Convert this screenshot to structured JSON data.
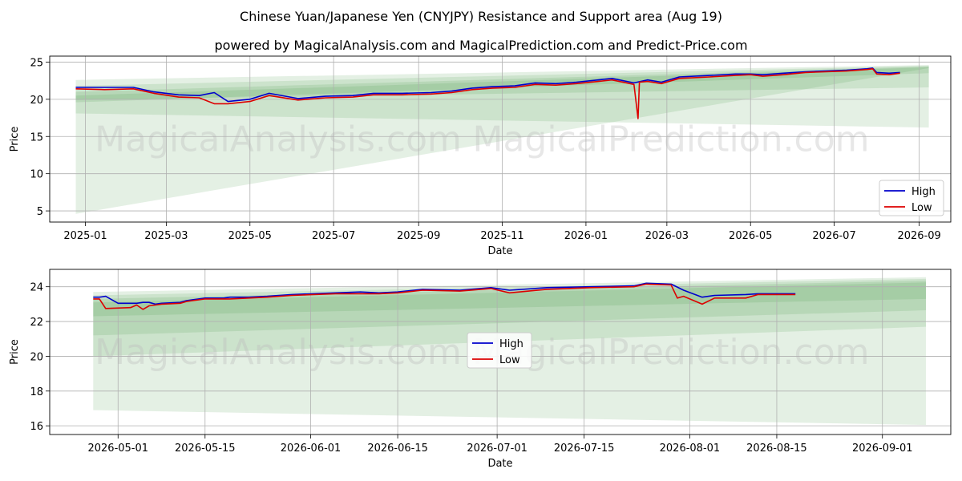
{
  "title": "Chinese Yuan/Japanese Yen (CNYJPY) Resistance and Support area (Aug 19)",
  "subtitle": "powered by MagicalAnalysis.com and MagicalPrediction.com and Predict-Price.com",
  "watermarks": [
    "MagicalAnalysis.com",
    "MagicalPrediction.com"
  ],
  "colors": {
    "high": "#0000cc",
    "low": "#dd0000",
    "band": "#2e8b2e",
    "grid": "#b0b0b0"
  },
  "chart_data": [
    {
      "type": "line",
      "xlabel": "Date",
      "ylabel": "Price",
      "ylim": [
        3.5,
        25.8
      ],
      "xlim": [
        "2024-12-06",
        "2026-09-24"
      ],
      "grid": true,
      "legend_position": "lower right",
      "x_ticks": [
        "2025-01",
        "2025-03",
        "2025-05",
        "2025-07",
        "2025-09",
        "2025-11",
        "2026-01",
        "2026-03",
        "2026-05",
        "2026-07",
        "2026-09"
      ],
      "y_ticks": [
        5,
        10,
        15,
        20,
        25
      ],
      "series": [
        {
          "name": "High",
          "color": "#0000cc",
          "x": [
            "2024-12-25",
            "2025-01-15",
            "2025-02-05",
            "2025-02-20",
            "2025-03-10",
            "2025-03-25",
            "2025-04-05",
            "2025-04-15",
            "2025-05-01",
            "2025-05-15",
            "2025-06-05",
            "2025-06-25",
            "2025-07-15",
            "2025-07-30",
            "2025-08-20",
            "2025-09-10",
            "2025-09-25",
            "2025-10-10",
            "2025-10-25",
            "2025-11-10",
            "2025-11-25",
            "2025-12-10",
            "2025-12-25",
            "2026-01-10",
            "2026-01-20",
            "2026-02-05",
            "2026-02-15",
            "2026-02-25",
            "2026-03-10",
            "2026-04-01",
            "2026-04-20",
            "2026-05-01",
            "2026-05-10",
            "2026-05-25",
            "2026-06-10",
            "2026-06-25",
            "2026-07-10",
            "2026-07-25",
            "2026-07-29",
            "2026-08-01",
            "2026-08-10",
            "2026-08-18"
          ],
          "y": [
            21.6,
            21.6,
            21.6,
            21.0,
            20.6,
            20.5,
            20.9,
            19.7,
            20.0,
            20.8,
            20.1,
            20.4,
            20.5,
            20.8,
            20.8,
            20.9,
            21.1,
            21.5,
            21.7,
            21.8,
            22.2,
            22.1,
            22.3,
            22.6,
            22.8,
            22.2,
            22.6,
            22.3,
            23.0,
            23.2,
            23.4,
            23.4,
            23.3,
            23.5,
            23.7,
            23.8,
            23.9,
            24.1,
            24.2,
            23.6,
            23.5,
            23.6
          ]
        },
        {
          "name": "Low",
          "color": "#dd0000",
          "x": [
            "2024-12-25",
            "2025-01-15",
            "2025-02-05",
            "2025-02-20",
            "2025-03-10",
            "2025-03-25",
            "2025-04-05",
            "2025-04-15",
            "2025-05-01",
            "2025-05-15",
            "2025-06-05",
            "2025-06-25",
            "2025-07-15",
            "2025-07-30",
            "2025-08-20",
            "2025-09-10",
            "2025-09-25",
            "2025-10-10",
            "2025-10-25",
            "2025-11-10",
            "2025-11-25",
            "2025-12-10",
            "2025-12-25",
            "2026-01-10",
            "2026-01-20",
            "2026-02-05",
            "2026-02-08",
            "2026-02-09",
            "2026-02-15",
            "2026-02-25",
            "2026-03-10",
            "2026-04-01",
            "2026-04-20",
            "2026-05-01",
            "2026-05-10",
            "2026-05-25",
            "2026-06-10",
            "2026-06-25",
            "2026-07-10",
            "2026-07-25",
            "2026-07-29",
            "2026-08-01",
            "2026-08-10",
            "2026-08-18"
          ],
          "y": [
            21.4,
            21.3,
            21.4,
            20.8,
            20.3,
            20.2,
            19.4,
            19.4,
            19.7,
            20.5,
            19.9,
            20.2,
            20.3,
            20.6,
            20.6,
            20.7,
            20.9,
            21.3,
            21.5,
            21.6,
            22.0,
            21.9,
            22.1,
            22.4,
            22.6,
            22.0,
            17.4,
            22.3,
            22.4,
            22.1,
            22.8,
            23.0,
            23.2,
            23.3,
            23.1,
            23.3,
            23.6,
            23.7,
            23.8,
            24.0,
            24.1,
            23.4,
            23.3,
            23.5
          ]
        }
      ],
      "bands": [
        {
          "x_start": "2024-12-25",
          "x_end": "2026-09-08",
          "upper": [
            22.6,
            24.6
          ],
          "lower": [
            4.6,
            24.2
          ]
        },
        {
          "x_start": "2024-12-25",
          "x_end": "2026-09-08",
          "upper": [
            21.8,
            24.5
          ],
          "lower": [
            18.1,
            16.2
          ]
        },
        {
          "x_start": "2024-12-25",
          "x_end": "2026-09-08",
          "upper": [
            21.0,
            24.4
          ],
          "lower": [
            19.9,
            21.6
          ]
        },
        {
          "x_start": "2024-12-25",
          "x_end": "2026-09-08",
          "upper": [
            20.5,
            24.3
          ],
          "lower": [
            19.6,
            23.5
          ]
        }
      ]
    },
    {
      "type": "line",
      "xlabel": "Date",
      "ylabel": "Price",
      "ylim": [
        15.5,
        25.0
      ],
      "xlim": [
        "2026-04-20",
        "2026-09-12"
      ],
      "grid": true,
      "legend_position": "center",
      "x_ticks": [
        "2026-05-01",
        "2026-05-15",
        "2026-06-01",
        "2026-06-15",
        "2026-07-01",
        "2026-07-15",
        "2026-08-01",
        "2026-08-15",
        "2026-09-01"
      ],
      "y_ticks": [
        16,
        18,
        20,
        22,
        24
      ],
      "series": [
        {
          "name": "High",
          "color": "#0000cc",
          "x": [
            "2026-04-27",
            "2026-04-28",
            "2026-04-29",
            "2026-05-01",
            "2026-05-04",
            "2026-05-05",
            "2026-05-06",
            "2026-05-07",
            "2026-05-08",
            "2026-05-11",
            "2026-05-12",
            "2026-05-13",
            "2026-05-14",
            "2026-05-15",
            "2026-05-18",
            "2026-05-19",
            "2026-05-22",
            "2026-05-25",
            "2026-05-29",
            "2026-06-05",
            "2026-06-09",
            "2026-06-12",
            "2026-06-15",
            "2026-06-19",
            "2026-06-25",
            "2026-06-30",
            "2026-07-03",
            "2026-07-09",
            "2026-07-16",
            "2026-07-23",
            "2026-07-25",
            "2026-07-29",
            "2026-07-31",
            "2026-08-03",
            "2026-08-05",
            "2026-08-10",
            "2026-08-12",
            "2026-08-18"
          ],
          "y": [
            23.4,
            23.4,
            23.45,
            23.05,
            23.05,
            23.1,
            23.1,
            23.0,
            23.05,
            23.1,
            23.2,
            23.25,
            23.3,
            23.35,
            23.35,
            23.4,
            23.4,
            23.45,
            23.55,
            23.65,
            23.7,
            23.65,
            23.7,
            23.85,
            23.8,
            23.95,
            23.8,
            23.95,
            24.0,
            24.05,
            24.2,
            24.15,
            23.8,
            23.4,
            23.5,
            23.55,
            23.6,
            23.6
          ]
        },
        {
          "name": "Low",
          "color": "#dd0000",
          "x": [
            "2026-04-27",
            "2026-04-28",
            "2026-04-29",
            "2026-05-03",
            "2026-05-04",
            "2026-05-05",
            "2026-05-06",
            "2026-05-07",
            "2026-05-08",
            "2026-05-11",
            "2026-05-12",
            "2026-05-13",
            "2026-05-14",
            "2026-05-15",
            "2026-05-18",
            "2026-05-19",
            "2026-05-22",
            "2026-05-25",
            "2026-05-29",
            "2026-06-05",
            "2026-06-09",
            "2026-06-12",
            "2026-06-15",
            "2026-06-19",
            "2026-06-25",
            "2026-06-30",
            "2026-07-03",
            "2026-07-09",
            "2026-07-16",
            "2026-07-23",
            "2026-07-25",
            "2026-07-29",
            "2026-07-30",
            "2026-07-31",
            "2026-08-03",
            "2026-08-05",
            "2026-08-10",
            "2026-08-12",
            "2026-08-18"
          ],
          "y": [
            23.3,
            23.3,
            22.75,
            22.8,
            22.95,
            22.7,
            22.9,
            22.95,
            23.0,
            23.05,
            23.15,
            23.2,
            23.25,
            23.3,
            23.3,
            23.3,
            23.35,
            23.4,
            23.5,
            23.6,
            23.6,
            23.6,
            23.65,
            23.8,
            23.75,
            23.9,
            23.65,
            23.85,
            23.95,
            24.0,
            24.15,
            24.1,
            23.35,
            23.45,
            23.0,
            23.35,
            23.35,
            23.55,
            23.55
          ]
        }
      ],
      "bands": [
        {
          "x_start": "2026-04-27",
          "x_end": "2026-09-08",
          "upper": [
            23.7,
            24.55
          ],
          "lower": [
            16.9,
            16.05
          ]
        },
        {
          "x_start": "2026-04-27",
          "x_end": "2026-09-08",
          "upper": [
            23.5,
            24.45
          ],
          "lower": [
            20.0,
            21.7
          ]
        },
        {
          "x_start": "2026-04-27",
          "x_end": "2026-09-08",
          "upper": [
            23.3,
            24.35
          ],
          "lower": [
            21.2,
            22.65
          ]
        },
        {
          "x_start": "2026-04-27",
          "x_end": "2026-09-08",
          "upper": [
            23.1,
            24.25
          ],
          "lower": [
            22.3,
            23.3
          ]
        }
      ]
    }
  ]
}
